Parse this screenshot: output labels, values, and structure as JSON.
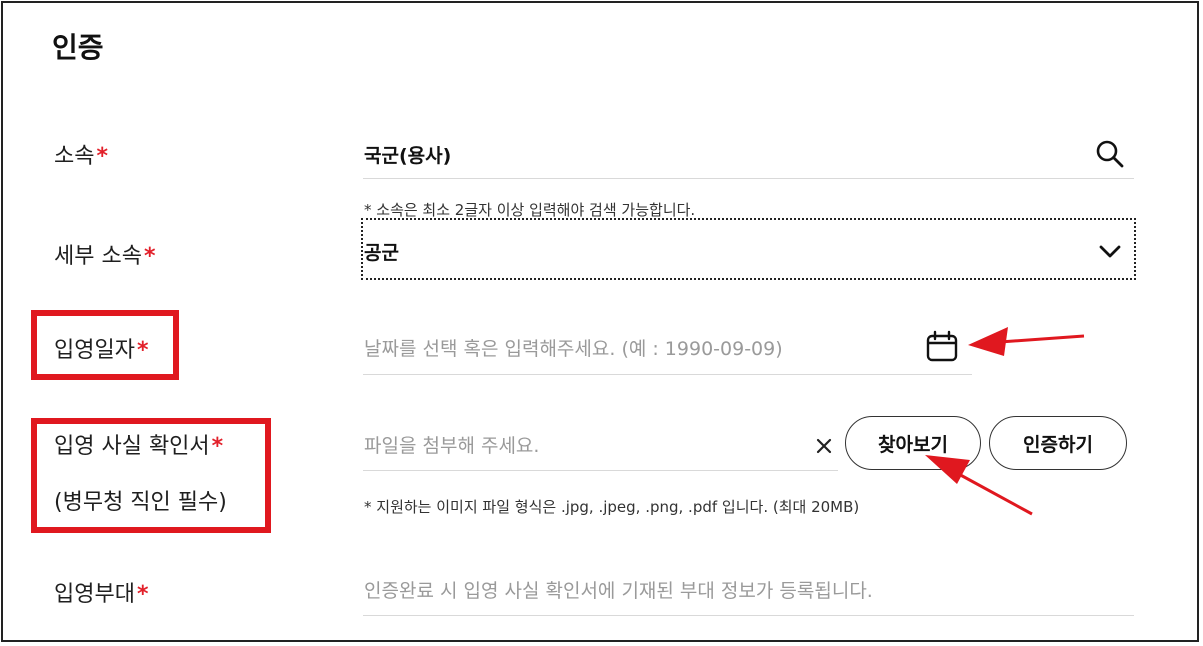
{
  "header": {
    "title": "인증"
  },
  "form": {
    "required_mark": "*",
    "affiliation": {
      "label": "소속",
      "value": "국군(용사)",
      "note": "* 소속은 최소 2글자 이상 입력해야 검색 가능합니다."
    },
    "sub_affiliation": {
      "label": "세부 소속",
      "value": "공군"
    },
    "enlist_date": {
      "label": "입영일자",
      "placeholder": "날짜를 선택 혹은 입력해주세요. (예 : 1990-09-09)"
    },
    "certificate": {
      "label_line1": "입영 사실 확인서",
      "label_line2": "(병무청 직인 필수)",
      "placeholder": "파일을 첨부해 주세요.",
      "clear_symbol": "×",
      "browse_label": "찾아보기",
      "verify_label": "인증하기",
      "note": "* 지원하는 이미지 파일 형식은 .jpg, .jpeg, .png, .pdf 입니다. (최대 20MB)"
    },
    "unit": {
      "label": "입영부대",
      "placeholder": "인증완료 시 입영 사실 확인서에 기재된 부대 정보가 등록됩니다."
    }
  },
  "colors": {
    "accent_red": "#e0181f",
    "required": "#e2202a"
  },
  "icons": [
    "search-icon",
    "chevron-down-icon",
    "calendar-icon",
    "clear-icon"
  ]
}
